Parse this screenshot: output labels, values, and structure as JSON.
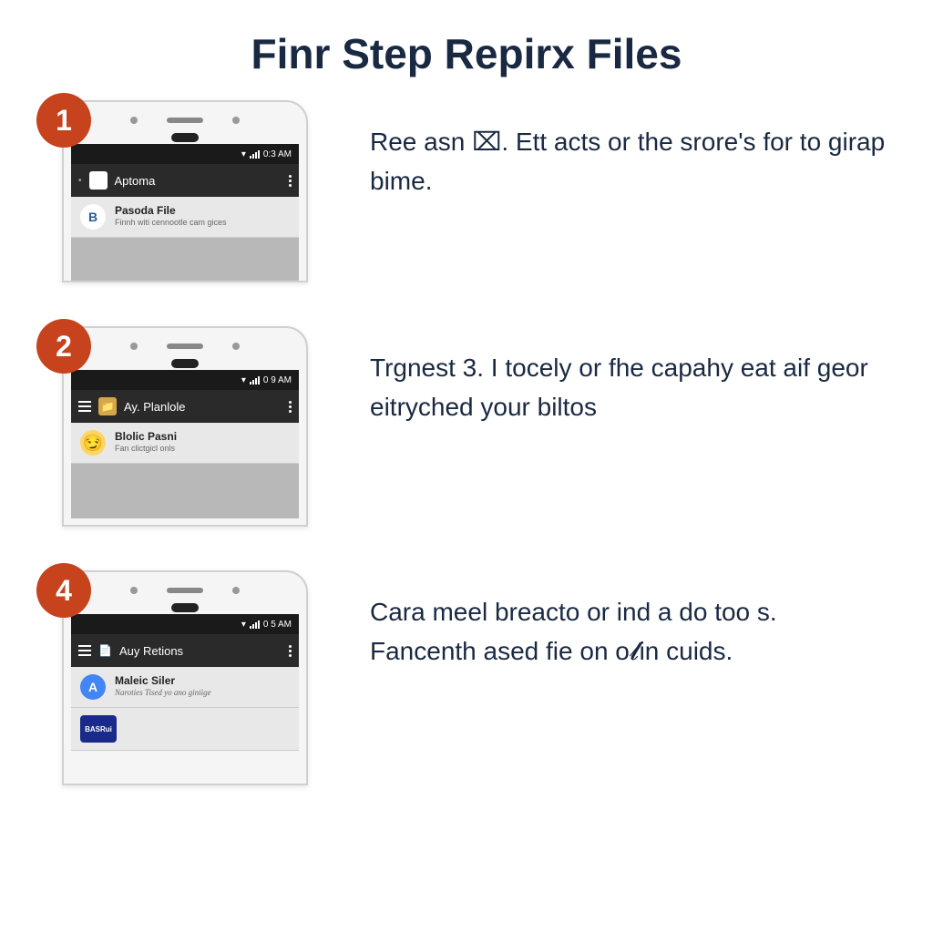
{
  "title": "Finr Step Repirx Files",
  "steps": [
    {
      "badge": "1",
      "status_time": "0:3 AM",
      "app_bar_title": "Aptoma",
      "notifs": [
        {
          "icon_type": "letter",
          "icon_text": "B",
          "title": "Pasoda File",
          "sub": "Finnh witi cennootle cam gices"
        }
      ],
      "text": "Ree asn ⌧. Ett acts or the srore's for to girap bime."
    },
    {
      "badge": "2",
      "status_time": "0 9 AM",
      "app_bar_title": "Ay. Planlole",
      "notifs": [
        {
          "icon_type": "emoji",
          "icon_text": "😏",
          "title": "Blolic Pasni",
          "sub": "Fan clictgicl onls"
        }
      ],
      "text": "Trgnest 3. I tocely or fhe capahy eat aif geor eitryched your biltos"
    },
    {
      "badge": "4",
      "status_time": "0 5 AM",
      "app_bar_title": "Auy Retions",
      "notifs": [
        {
          "icon_type": "blue",
          "icon_text": "A",
          "title": "Maleic Siler",
          "sub": "Naroties Tised yo ano giniige"
        },
        {
          "icon_type": "square",
          "icon_text": "BASRui",
          "title": "",
          "sub": ""
        }
      ],
      "text": "Cara meel breacto or ind a do too s. Fancenth ased fie on o𝓵in cuids."
    }
  ]
}
